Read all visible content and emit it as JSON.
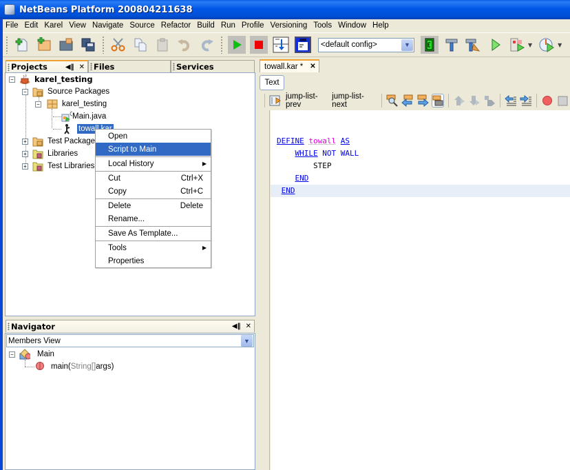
{
  "window": {
    "title": "NetBeans Platform 200804211638"
  },
  "menubar": [
    "File",
    "Edit",
    "Karel",
    "View",
    "Navigate",
    "Source",
    "Refactor",
    "Build",
    "Run",
    "Profile",
    "Versioning",
    "Tools",
    "Window",
    "Help"
  ],
  "toolbar": {
    "config_value": "<default config>",
    "buttons": [
      "new-file",
      "new-project",
      "open-project",
      "save-all",
      "cut",
      "copy",
      "paste",
      "undo",
      "redo",
      "run-karel",
      "stop-karel",
      "step-karel",
      "save-world",
      "karel-book",
      "build",
      "clean-build",
      "run",
      "debug",
      "profile"
    ]
  },
  "projects_panel": {
    "tabs": [
      {
        "label": "Projects",
        "active": true
      },
      {
        "label": "Files",
        "active": false
      },
      {
        "label": "Services",
        "active": false
      }
    ],
    "tree": [
      {
        "label": "karel_testing",
        "level": 0,
        "expanded": true,
        "bold": true
      },
      {
        "label": "Source Packages",
        "level": 1,
        "expanded": true
      },
      {
        "label": "karel_testing",
        "level": 2,
        "expanded": true
      },
      {
        "label": "Main.java",
        "level": 3
      },
      {
        "label": "towall.kar",
        "level": 3,
        "selected": true
      },
      {
        "label": "Test Packages",
        "level": 1,
        "expanded": false
      },
      {
        "label": "Libraries",
        "level": 1,
        "expanded": false
      },
      {
        "label": "Test Libraries",
        "level": 1,
        "expanded": false
      }
    ]
  },
  "context_menu": {
    "items": [
      {
        "label": "Open"
      },
      {
        "label": "Script to Main",
        "highlighted": true
      },
      {
        "label": "Local History",
        "submenu": true
      },
      {
        "label": "Cut",
        "shortcut": "Ctrl+X"
      },
      {
        "label": "Copy",
        "shortcut": "Ctrl+C"
      },
      {
        "label": "Delete",
        "shortcut": "Delete"
      },
      {
        "label": "Rename..."
      },
      {
        "label": "Save As Template..."
      },
      {
        "label": "Tools",
        "submenu": true
      },
      {
        "label": "Properties"
      }
    ]
  },
  "navigator": {
    "title": "Navigator",
    "view": "Members View",
    "tree": [
      {
        "label": "Main"
      },
      {
        "label": "main(",
        "type": "String[]",
        "rest": " args)"
      }
    ]
  },
  "editor": {
    "tab_label": "towall.kar *",
    "view_tab": "Text",
    "jump_prev": "jump-list-prev",
    "jump_next": "jump-list-next",
    "code": {
      "line1": {
        "kw1": "DEFINE",
        "id": "towall",
        "kw2": "AS"
      },
      "line2": {
        "kw1": "WHILE",
        "rest": "NOT WALL"
      },
      "line3": {
        "text": "STEP"
      },
      "line4": {
        "kw": "END"
      },
      "line5": {
        "kw": "END"
      }
    }
  }
}
